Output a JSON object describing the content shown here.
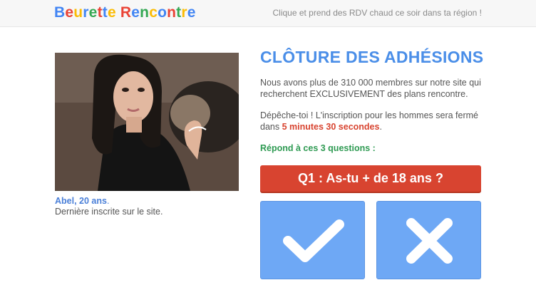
{
  "header": {
    "logo_parts": [
      {
        "text": "B",
        "color": "#4285f4"
      },
      {
        "text": "e",
        "color": "#ea4335"
      },
      {
        "text": "u",
        "color": "#fbbc05"
      },
      {
        "text": "r",
        "color": "#4285f4"
      },
      {
        "text": "e",
        "color": "#34a853"
      },
      {
        "text": "t",
        "color": "#ea4335"
      },
      {
        "text": "t",
        "color": "#4285f4"
      },
      {
        "text": "e",
        "color": "#fbbc05"
      },
      {
        "text": " ",
        "color": "#000000"
      },
      {
        "text": "R",
        "color": "#ea4335"
      },
      {
        "text": "e",
        "color": "#4285f4"
      },
      {
        "text": "n",
        "color": "#34a853"
      },
      {
        "text": "c",
        "color": "#fbbc05"
      },
      {
        "text": "o",
        "color": "#4285f4"
      },
      {
        "text": "n",
        "color": "#ea4335"
      },
      {
        "text": "t",
        "color": "#34a853"
      },
      {
        "text": "r",
        "color": "#fbbc05"
      },
      {
        "text": "e",
        "color": "#4285f4"
      }
    ],
    "tagline": "Clique et prend des RDV chaud ce soir dans ta région !"
  },
  "profile": {
    "name": "Abel, 20 ans",
    "name_suffix": ".",
    "subtitle": "Dernière inscrite sur le site."
  },
  "main": {
    "headline": "CLÔTURE DES ADHÉSIONS",
    "paragraph1": "Nous avons plus de 310 000 membres sur notre site qui recherchent EXCLUSIVEMENT des plans rencontre.",
    "paragraph2_prefix": "Dépêche-toi ! L'inscription pour les hommes sera fermé dans ",
    "countdown": "5 minutes 30 secondes",
    "paragraph2_suffix": ".",
    "answer_prompt": "Répond à ces 3 questions :",
    "question": "Q1 : As-tu + de 18 ans ?",
    "yes_icon": "check-icon",
    "no_icon": "cross-icon"
  },
  "colors": {
    "accent_blue": "#4a8ee8",
    "question_red": "#d84430",
    "prompt_green": "#2e9a52",
    "button_blue": "#6ea8f5"
  }
}
